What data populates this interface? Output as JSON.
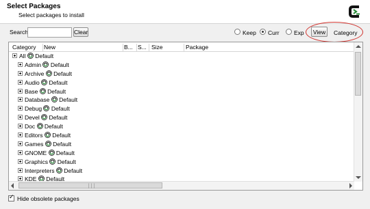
{
  "header": {
    "title": "Select Packages",
    "subtitle": "Select packages to install"
  },
  "toolbar": {
    "search_label": "Search",
    "search_value": "",
    "clear_label": "Clear",
    "radios": [
      {
        "label": "Keep",
        "selected": false
      },
      {
        "label": "Curr",
        "selected": true
      },
      {
        "label": "Exp",
        "selected": false
      }
    ],
    "view_label": "View",
    "view_mode": "Category"
  },
  "columns": [
    "Category",
    "New",
    "B...",
    "S...",
    "Size",
    "Package"
  ],
  "tree": {
    "root": {
      "label": "All",
      "action": "Default"
    },
    "items": [
      {
        "label": "Admin",
        "action": "Default"
      },
      {
        "label": "Archive",
        "action": "Default"
      },
      {
        "label": "Audio",
        "action": "Default"
      },
      {
        "label": "Base",
        "action": "Default"
      },
      {
        "label": "Database",
        "action": "Default"
      },
      {
        "label": "Debug",
        "action": "Default"
      },
      {
        "label": "Devel",
        "action": "Default"
      },
      {
        "label": "Doc",
        "action": "Default"
      },
      {
        "label": "Editors",
        "action": "Default"
      },
      {
        "label": "Games",
        "action": "Default"
      },
      {
        "label": "GNOME",
        "action": "Default"
      },
      {
        "label": "Graphics",
        "action": "Default"
      },
      {
        "label": "Interpreters",
        "action": "Default"
      },
      {
        "label": "KDE",
        "action": "Default"
      }
    ]
  },
  "footer": {
    "hide_obsolete_label": "Hide obsolete packages",
    "hide_obsolete_checked": true
  },
  "colors": {
    "highlight": "#d0322d",
    "logo_green": "#2a8c3a"
  }
}
